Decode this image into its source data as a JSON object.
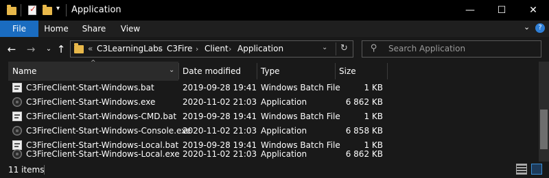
{
  "window": {
    "title": "Application"
  },
  "ribbon": {
    "tabs": [
      "File",
      "Home",
      "Share",
      "View"
    ]
  },
  "address": {
    "path": [
      "C3LearningLabs",
      "C3Fire",
      "Client",
      "Application"
    ],
    "overflow": "«"
  },
  "search": {
    "placeholder": "Search Application"
  },
  "columns": [
    "Name",
    "Date modified",
    "Type",
    "Size"
  ],
  "files": [
    {
      "name": "C3FireClient-Start-Windows.bat",
      "date": "2019-09-28 19:41",
      "type": "Windows Batch File",
      "size": "1 KB",
      "icon": "batch-file-icon"
    },
    {
      "name": "C3FireClient-Start-Windows.exe",
      "date": "2020-11-02 21:03",
      "type": "Application",
      "size": "6 862 KB",
      "icon": "application-icon"
    },
    {
      "name": "C3FireClient-Start-Windows-CMD.bat",
      "date": "2019-09-28 19:41",
      "type": "Windows Batch File",
      "size": "1 KB",
      "icon": "batch-file-icon"
    },
    {
      "name": "C3FireClient-Start-Windows-Console.exe",
      "date": "2020-11-02 21:03",
      "type": "Application",
      "size": "6 858 KB",
      "icon": "application-icon"
    },
    {
      "name": "C3FireClient-Start-Windows-Local.bat",
      "date": "2019-09-28 19:41",
      "type": "Windows Batch File",
      "size": "1 KB",
      "icon": "batch-file-icon"
    },
    {
      "name": "C3FireClient-Start-Windows-Local.exe",
      "date": "2020-11-02 21:03",
      "type": "Application",
      "size": "6 862 KB",
      "icon": "application-icon"
    }
  ],
  "status": {
    "item_count": "11 items"
  },
  "colors": {
    "file_tab": "#1a6cc0",
    "background": "#191919",
    "folder": "#e8b84a"
  }
}
